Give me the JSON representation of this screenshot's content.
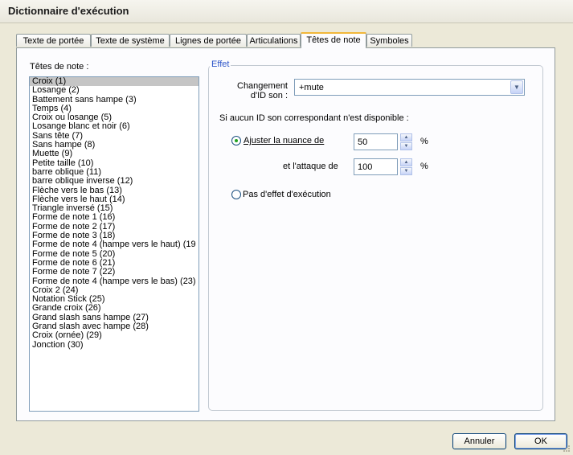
{
  "window": {
    "title": "Dictionnaire d'exécution"
  },
  "tabs": [
    {
      "label": "Texte de portée",
      "active": false
    },
    {
      "label": "Texte de système",
      "active": false
    },
    {
      "label": "Lignes de portée",
      "active": false
    },
    {
      "label": "Articulations",
      "active": false
    },
    {
      "label": "Têtes de note",
      "active": true
    },
    {
      "label": "Symboles",
      "active": false
    }
  ],
  "noteheads": {
    "label": "Têtes de note :",
    "items": [
      "Croix (1)",
      "Losange (2)",
      "Battement sans hampe (3)",
      "Temps (4)",
      "Croix ou losange (5)",
      "Losange blanc et noir (6)",
      "Sans tête (7)",
      "Sans hampe (8)",
      "Muette (9)",
      "Petite taille (10)",
      "barre oblique (11)",
      "barre oblique inverse (12)",
      "Flèche vers le bas (13)",
      "Flèche vers le haut (14)",
      "Triangle inversé (15)",
      "Forme de note 1 (16)",
      "Forme de note 2 (17)",
      "Forme de note 3 (18)",
      "Forme de note 4 (hampe vers le haut) (19",
      "Forme de note 5 (20)",
      "Forme de note 6 (21)",
      "Forme de note 7 (22)",
      "Forme de note 4 (hampe vers le bas) (23)",
      "Croix 2 (24)",
      "Notation Stick (25)",
      "Grande croix (26)",
      "Grand slash sans hampe (27)",
      "Grand slash avec hampe (28)",
      "Croix (ornée) (29)",
      "Jonction (30)"
    ],
    "selected_index": 0
  },
  "effect": {
    "group_label": "Effet",
    "sound_id_label_line1": "Changement",
    "sound_id_label_line2": "d'ID son :",
    "sound_id_value": "+mute",
    "fallback_label": "Si aucun ID son correspondant n'est disponible :",
    "option_adjust_label": "Ajuster la nuance de",
    "dynamics_value": "50",
    "attack_label": "et l'attaque de",
    "attack_value": "100",
    "percent": "%",
    "option_none_label": "Pas d'effet d'exécution",
    "selected_option": "adjust"
  },
  "buttons": {
    "cancel": "Annuler",
    "ok": "OK"
  },
  "icons": {
    "dropdown": "chevron-down-icon",
    "spin": "spin-up-down-icon"
  }
}
